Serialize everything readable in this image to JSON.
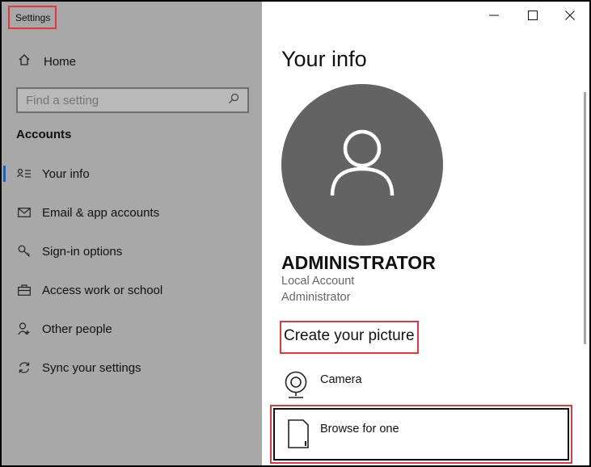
{
  "window": {
    "title": "Settings"
  },
  "sidebar": {
    "home_label": "Home",
    "search": {
      "placeholder": "Find a setting"
    },
    "section_title": "Accounts",
    "items": [
      {
        "label": "Your info",
        "icon": "user-card-icon",
        "active": true
      },
      {
        "label": "Email & app accounts",
        "icon": "mail-icon",
        "active": false
      },
      {
        "label": "Sign-in options",
        "icon": "key-icon",
        "active": false
      },
      {
        "label": "Access work or school",
        "icon": "briefcase-icon",
        "active": false
      },
      {
        "label": "Other people",
        "icon": "person-add-icon",
        "active": false
      },
      {
        "label": "Sync your settings",
        "icon": "sync-icon",
        "active": false
      }
    ]
  },
  "main": {
    "title": "Your info",
    "user": {
      "name": "ADMINISTRATOR",
      "account_type": "Local Account",
      "role": "Administrator"
    },
    "create_picture": {
      "title": "Create your picture",
      "options": [
        {
          "label": "Camera",
          "icon": "camera-icon"
        },
        {
          "label": "Browse for one",
          "icon": "file-icon"
        }
      ]
    }
  },
  "colors": {
    "sidebar_bg": "#a8a8a8",
    "accent": "#0a66c8",
    "highlight": "#e0383f",
    "avatar_bg": "#636363"
  }
}
